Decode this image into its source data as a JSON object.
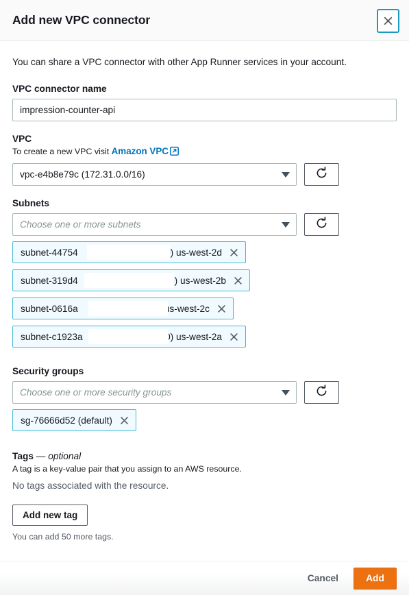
{
  "dialog": {
    "title": "Add new VPC connector",
    "close_icon": "close-icon",
    "intro": "You can share a VPC connector with other App Runner services in your account."
  },
  "connector_name": {
    "label": "VPC connector name",
    "value": "impression-counter-api",
    "placeholder": ""
  },
  "vpc": {
    "label": "VPC",
    "hint_prefix": "To create a new VPC visit ",
    "link_text": "Amazon VPC",
    "link_icon": "external-link-icon",
    "selected": "vpc-e4b8e79c (172.31.0.0/16)",
    "refresh_icon": "refresh-icon"
  },
  "subnets": {
    "label": "Subnets",
    "placeholder": "Choose one or more subnets",
    "refresh_icon": "refresh-icon",
    "tokens": [
      {
        "prefix": "subnet-44754",
        "suffix": "/20) us-west-2d",
        "dismiss_icon": "remove-icon"
      },
      {
        "prefix": "subnet-319d4",
        "suffix": "/20) us-west-2b",
        "dismiss_icon": "remove-icon"
      },
      {
        "prefix": "subnet-0616a",
        "suffix": "20) us-west-2c",
        "dismiss_icon": "remove-icon"
      },
      {
        "prefix": "subnet-c1923a",
        "suffix": "/20) us-west-2a",
        "dismiss_icon": "remove-icon"
      }
    ]
  },
  "security_groups": {
    "label": "Security groups",
    "placeholder": "Choose one or more security groups",
    "refresh_icon": "refresh-icon",
    "tokens": [
      {
        "label": "sg-76666d52 (default)",
        "dismiss_icon": "remove-icon"
      }
    ]
  },
  "tags": {
    "heading_main": "Tags",
    "heading_dash": " — ",
    "heading_optional": "optional",
    "description": "A tag is a key-value pair that you assign to an AWS resource.",
    "empty_text": "No tags associated with the resource.",
    "add_button": "Add new tag",
    "note": "You can add 50 more tags."
  },
  "footer": {
    "cancel_label": "Cancel",
    "add_label": "Add"
  },
  "colors": {
    "accent_orange": "#ec7211",
    "link_blue": "#0073bb",
    "token_border": "#44b9d6",
    "focus_ring": "#1a9ac0"
  }
}
